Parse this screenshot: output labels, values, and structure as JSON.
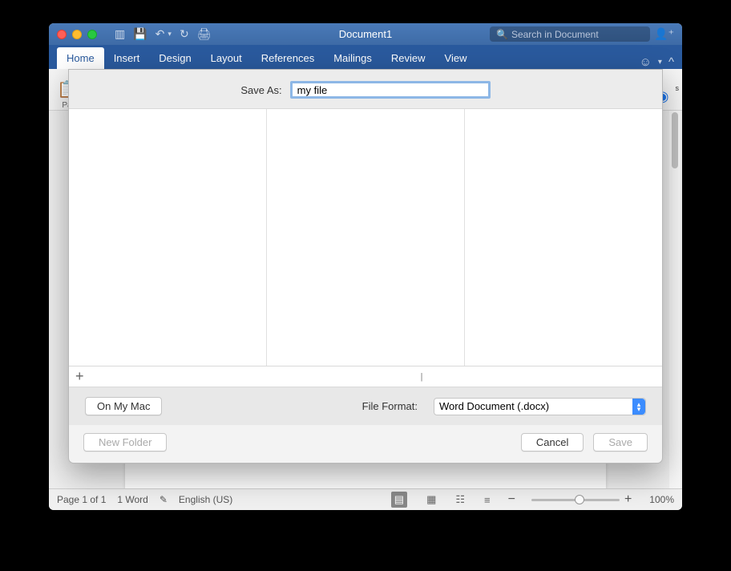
{
  "window": {
    "title": "Document1"
  },
  "search": {
    "placeholder": "Search in Document"
  },
  "ribbon": {
    "tabs": [
      "Home",
      "Insert",
      "Design",
      "Layout",
      "References",
      "Mailings",
      "Review",
      "View"
    ],
    "active": "Home"
  },
  "toolbar": {
    "paste_label": "Pa"
  },
  "statusbar": {
    "page": "Page 1 of 1",
    "words": "1 Word",
    "lang": "English (US)",
    "zoom": "100%",
    "minus": "−",
    "plus": "+"
  },
  "dialog": {
    "save_as_label": "Save As:",
    "filename": "my file",
    "on_my_mac": "On My Mac",
    "file_format_label": "File Format:",
    "file_format_value": "Word Document (.docx)",
    "new_folder": "New Folder",
    "cancel": "Cancel",
    "save": "Save",
    "add": "+"
  }
}
